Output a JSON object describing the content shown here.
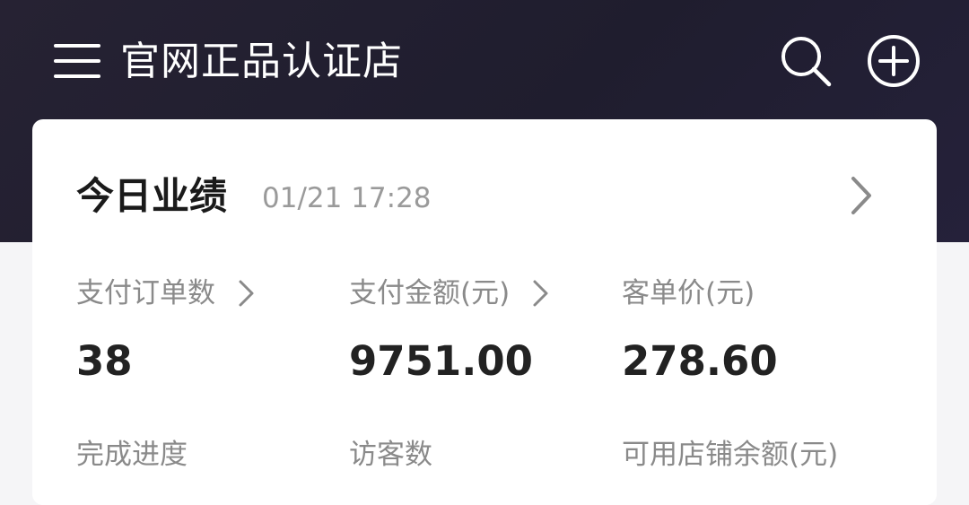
{
  "header": {
    "title": "官网正品认证店",
    "icons": {
      "menu": "menu-icon",
      "search": "search-icon",
      "add": "plus-circle-icon"
    },
    "background_color": "#23202f"
  },
  "performance": {
    "title": "今日业绩",
    "time": "01/21 17:28",
    "metrics": [
      {
        "label": "支付订单数",
        "value": "38",
        "has_arrow": true
      },
      {
        "label": "支付金额(元)",
        "value": "9751.00",
        "has_arrow": true
      },
      {
        "label": "客单价(元)",
        "value": "278.60",
        "has_arrow": false
      },
      {
        "label": "完成进度",
        "value": "",
        "has_arrow": false
      },
      {
        "label": "访客数",
        "value": "",
        "has_arrow": false
      },
      {
        "label": "可用店铺余额(元)",
        "value": "",
        "has_arrow": false
      }
    ]
  }
}
